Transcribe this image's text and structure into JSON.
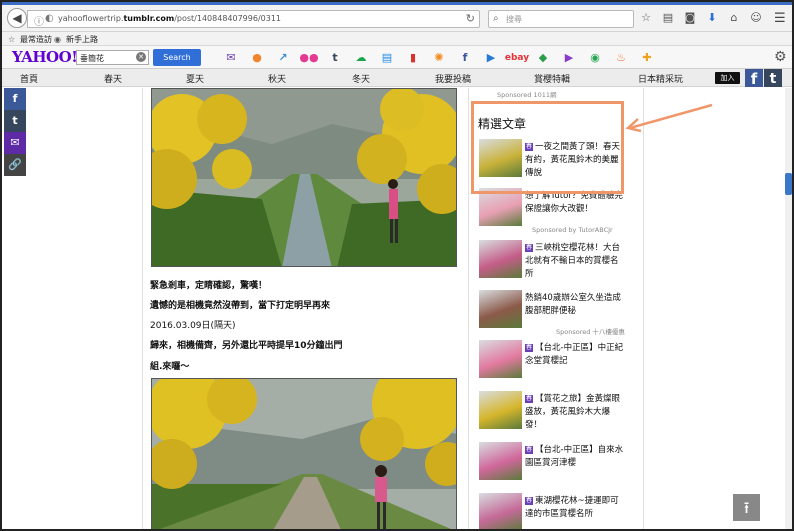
{
  "browser": {
    "url_prefix": "yahooflowertrip.",
    "url_host": "tumblr.com",
    "url_path": "/post/140848407996/0311",
    "search_placeholder": "搜尋"
  },
  "bookmarks": [
    {
      "label": "最常造訪"
    },
    {
      "label": "新手上路"
    }
  ],
  "yahoo_toolbar": {
    "logo": "YAHOO!",
    "search_value": "垂簡花",
    "search_button": "Search",
    "icons": [
      {
        "name": "mail-icon",
        "color": "#6b3fb6"
      },
      {
        "name": "sports-icon",
        "color": "#f0852d"
      },
      {
        "name": "finance-icon",
        "color": "#3b8ed8"
      },
      {
        "name": "flickr-icon",
        "color": "#e43a8f"
      },
      {
        "name": "tumblr-icon",
        "color": "#36465d"
      },
      {
        "name": "weather-icon",
        "color": "#19a34a"
      },
      {
        "name": "news-icon",
        "color": "#1e88e5"
      },
      {
        "name": "bookmark-icon",
        "color": "#d8342f"
      },
      {
        "name": "sun-icon",
        "color": "#f28b1e"
      },
      {
        "name": "facebook-icon",
        "color": "#3b5998"
      },
      {
        "name": "video-icon",
        "color": "#2779d6"
      },
      {
        "name": "ebay-icon",
        "color": "#e53238"
      },
      {
        "name": "tag-icon",
        "color": "#2e9d4a"
      },
      {
        "name": "movie-icon",
        "color": "#8a3cc9"
      },
      {
        "name": "games-icon",
        "color": "#27a852"
      },
      {
        "name": "food-icon",
        "color": "#ef6c2f"
      },
      {
        "name": "add-icon",
        "color": "#f0a21a"
      }
    ]
  },
  "site_nav": {
    "items": [
      "首頁",
      "春天",
      "夏天",
      "秋天",
      "冬天",
      "我要投稿",
      "賞櫻特輯",
      "日本精采玩"
    ],
    "follow_label": "加入"
  },
  "side_share": [
    {
      "name": "share-facebook-icon",
      "glyph": "f",
      "color": "#3b5998"
    },
    {
      "name": "share-tumblr-icon",
      "glyph": "t",
      "color": "#36465d"
    },
    {
      "name": "share-email-icon",
      "glyph": "✉",
      "color": "#5e2aa6"
    },
    {
      "name": "share-link-icon",
      "glyph": "🔗",
      "color": "#444"
    }
  ],
  "post": {
    "lines": [
      "緊急剎車，定睛確認，驚嘆！",
      "遺憾的是相機竟然沒帶到，當下打定明早再來",
      "2016.03.09日(隔天)",
      "歸來，相機備齊，另外還比平時提早10分鐘出門",
      "組.來囉～"
    ]
  },
  "sidebar": {
    "sponsored_top": "Sponsored 1011網",
    "featured_title": "精選文章",
    "items": [
      {
        "tag": "春",
        "text": "一夜之間黃了頭！春天有約，黃花風鈴木的美麗傳說",
        "thumb": "#c9b23a"
      },
      {
        "tag": "",
        "text": "想了解Tutor？免費體驗完保證讓你大改觀！",
        "thumb": "#e8a0b4"
      },
      {
        "tag": "春",
        "text": "三峽桃空櫻花林！大台北就有不輸日本的賞櫻名所",
        "thumb": "#c45d88"
      },
      {
        "tag": "",
        "text": "熱銷40歲辦公室久坐造成腹部肥胖便秘",
        "thumb": "#8c5a4a"
      },
      {
        "tag": "春",
        "text": "【台北-中正區】中正紀念堂賞櫻記",
        "thumb": "#e27aa0"
      },
      {
        "tag": "春",
        "text": "【賞花之旅】金黃燦眼盛放，黃花風鈴木大爆發！",
        "thumb": "#d6b62c"
      },
      {
        "tag": "春",
        "text": "【台北-中正區】自來水園區賞河津櫻",
        "thumb": "#d0679b"
      },
      {
        "tag": "春",
        "text": "東湖櫻花林~捷運即可達的市區賞櫻名所",
        "thumb": "#c56a98"
      }
    ],
    "sponsored_1": "Sponsored by TutorABCJr",
    "sponsored_2": "Sponsored 十八樓優惠"
  },
  "annotation": {
    "box_color": "#f0976a"
  }
}
